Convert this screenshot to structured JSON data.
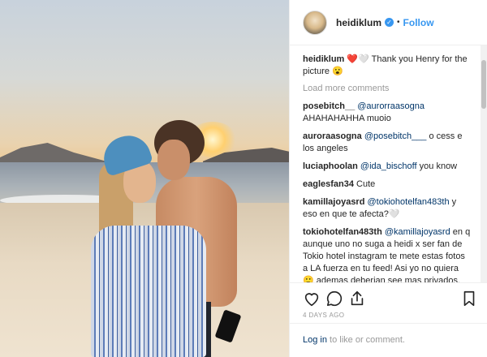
{
  "post": {
    "username": "heidiklum",
    "follow_separator": "•",
    "follow_label": "Follow",
    "verified_glyph": "✓"
  },
  "caption": {
    "username": "heidiklum",
    "text": "❤️🤍 Thank you Henry for the picture 😮"
  },
  "load_more": "Load more comments",
  "comments": [
    {
      "user": "posebitch__",
      "mention": "@aurorraasogna",
      "text": "AHAHAHAHHA muoio"
    },
    {
      "user": "auroraasogna",
      "mention": "@posebitch___",
      "text": "o cess e los angeles"
    },
    {
      "user": "luciaphoolan",
      "mention": "@ida_bischoff",
      "text": "you know"
    },
    {
      "user": "eaglesfan34",
      "mention": "",
      "text": "Cute"
    },
    {
      "user": "kamillajoyasrd",
      "mention": "@tokiohotelfan483th",
      "text": "y eso en que te afecta?🤍"
    },
    {
      "user": "tokiohotelfan483th",
      "mention": "@kamillajoyasrd",
      "text": "en q aunque uno no suga a heidi x ser fan de Tokio hotel instagram te mete estas fotos a LA fuerza en tu feed! Asi yo no quiera 🙂 ademas deberian see mas privados. no to-do el mundo esta interesado en lo q hacen! Y tu quien eres no te importa!"
    }
  ],
  "actions": {
    "like_icon": "heart-icon",
    "comment_icon": "comment-icon",
    "share_icon": "share-icon",
    "save_icon": "bookmark-icon"
  },
  "timestamp": "4 DAYS AGO",
  "footer": {
    "login_label": "Log in",
    "rest": " to like or comment."
  },
  "colors": {
    "link_blue": "#3897f0",
    "mention_blue": "#003569",
    "muted": "#999999"
  }
}
